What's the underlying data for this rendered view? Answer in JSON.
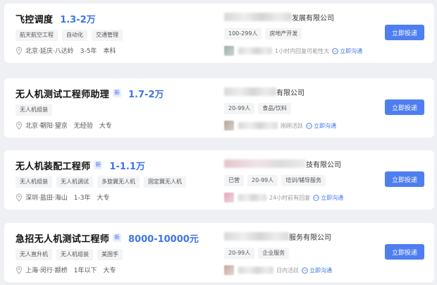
{
  "jobs": [
    {
      "title": "飞控调度",
      "new_badge": "",
      "salary": "1.3-2万",
      "tags": [
        "航天航空工程",
        "自动化",
        "交通管理"
      ],
      "location": "北京·延庆·八达岭",
      "experience": "3-5年",
      "education": "本科",
      "company_suffix": "发展有限公司",
      "company_tags": [
        "100-299人",
        "房地产开发"
      ],
      "status": "1小时内回复可能性大",
      "chat_label": "立即沟通",
      "apply_label": "立即投递"
    },
    {
      "title": "无人机测试工程师助理",
      "new_badge": "新",
      "salary": "1.7-2万",
      "tags": [
        "无人机组装"
      ],
      "location": "北京·朝阳·望京",
      "experience": "无经验",
      "education": "大专",
      "company_suffix": "有限公司",
      "company_tags": [
        "20-99人",
        "食品/饮料"
      ],
      "status": "刚刚活跃",
      "chat_label": "立即沟通",
      "apply_label": "立即投递"
    },
    {
      "title": "无人机装配工程师",
      "new_badge": "新",
      "salary": "1-1.1万",
      "tags": [
        "无人机组装",
        "无人机调试",
        "多旋翼无人机",
        "固定翼无人机"
      ],
      "location": "深圳·盐田·海山",
      "experience": "1-3年",
      "education": "大专",
      "company_suffix": "技有限公司",
      "company_tags": [
        "已营",
        "20-99人",
        "培训/辅导服务"
      ],
      "status": "24小时前有回复",
      "chat_label": "立即沟通",
      "apply_label": "立即投递"
    },
    {
      "title": "急招无人机测试工程师",
      "new_badge": "新",
      "salary": "8000-10000元",
      "tags": [
        "无人直升机",
        "无人机组装",
        "美国手"
      ],
      "location": "上海·闵行·颛桥",
      "experience": "1年以下",
      "education": "大专",
      "company_suffix": "服务有限公司",
      "company_tags": [
        "20-99人",
        "企业服务"
      ],
      "status": "日内活跃",
      "chat_label": "立即沟通",
      "apply_label": "立即投递"
    }
  ],
  "colors": {
    "accent": "#3e74e8",
    "button": "#4f7ef0"
  }
}
